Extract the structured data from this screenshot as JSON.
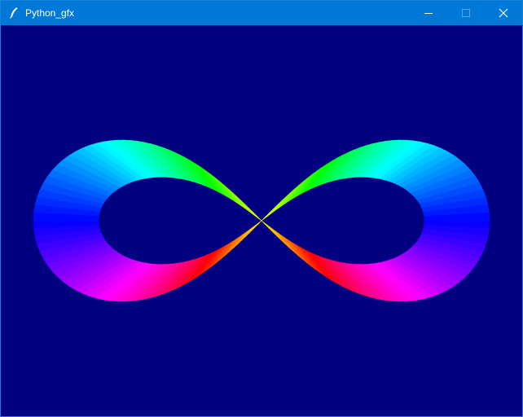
{
  "window": {
    "title": "Python_gfx",
    "background_color": "#000080",
    "titlebar_color": "#0078d7",
    "icon": "feather-icon"
  },
  "controls": {
    "minimize": "minimize-icon",
    "maximize": "maximize-icon",
    "close": "close-icon"
  },
  "drawing": {
    "shape": "infinity-ribbon",
    "fill": "rainbow-hue-gradient"
  }
}
